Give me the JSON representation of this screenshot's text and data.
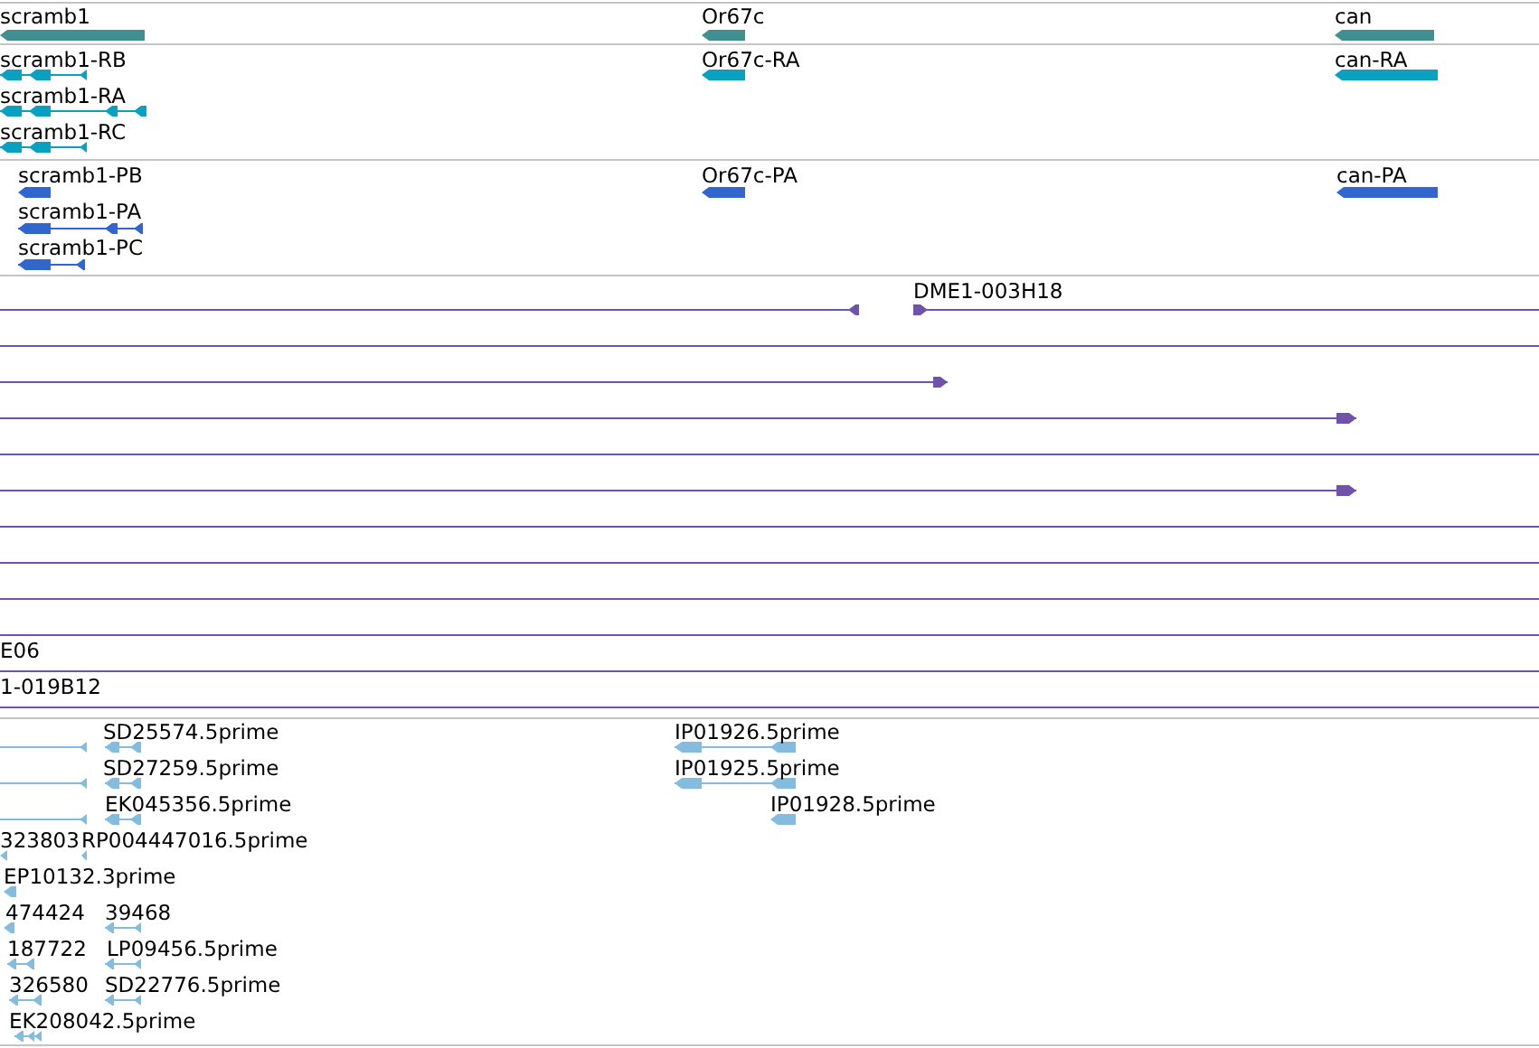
{
  "tracks": [
    {
      "kind": "gene",
      "color": "#418f91",
      "features": [
        {
          "label": "scramb1"
        },
        {
          "label": "Or67c"
        },
        {
          "label": "can"
        }
      ]
    },
    {
      "kind": "transcript",
      "color": "#0aa0c0",
      "features": [
        {
          "label": "scramb1-RB"
        },
        {
          "label": "scramb1-RA"
        },
        {
          "label": "scramb1-RC"
        },
        {
          "label": "Or67c-RA"
        },
        {
          "label": "can-RA"
        }
      ]
    },
    {
      "kind": "protein",
      "color": "#3366cc",
      "features": [
        {
          "label": "scramb1-PB"
        },
        {
          "label": "scramb1-PA"
        },
        {
          "label": "scramb1-PC"
        },
        {
          "label": "Or67c-PA"
        },
        {
          "label": "can-PA"
        }
      ]
    },
    {
      "kind": "clone",
      "color": "#7052aa",
      "features": [
        {
          "label": "DME1-003H18"
        },
        {
          "label": "E06"
        },
        {
          "label": "1-019B12"
        }
      ]
    },
    {
      "kind": "est",
      "color": "#84bcdf",
      "features": [
        {
          "label": "SD25574.5prime"
        },
        {
          "label": "IP01926.5prime"
        },
        {
          "label": "SD27259.5prime"
        },
        {
          "label": "IP01925.5prime"
        },
        {
          "label": "EK045356.5prime"
        },
        {
          "label": "IP01928.5prime"
        },
        {
          "label": "323803"
        },
        {
          "label": "RP004447016.5prime"
        },
        {
          "label": "EP10132.3prime"
        },
        {
          "label": "474424"
        },
        {
          "label": "39468"
        },
        {
          "label": "187722"
        },
        {
          "label": "LP09456.5prime"
        },
        {
          "label": "326580"
        },
        {
          "label": "SD22776.5prime"
        },
        {
          "label": "EK208042.5prime"
        }
      ]
    }
  ]
}
